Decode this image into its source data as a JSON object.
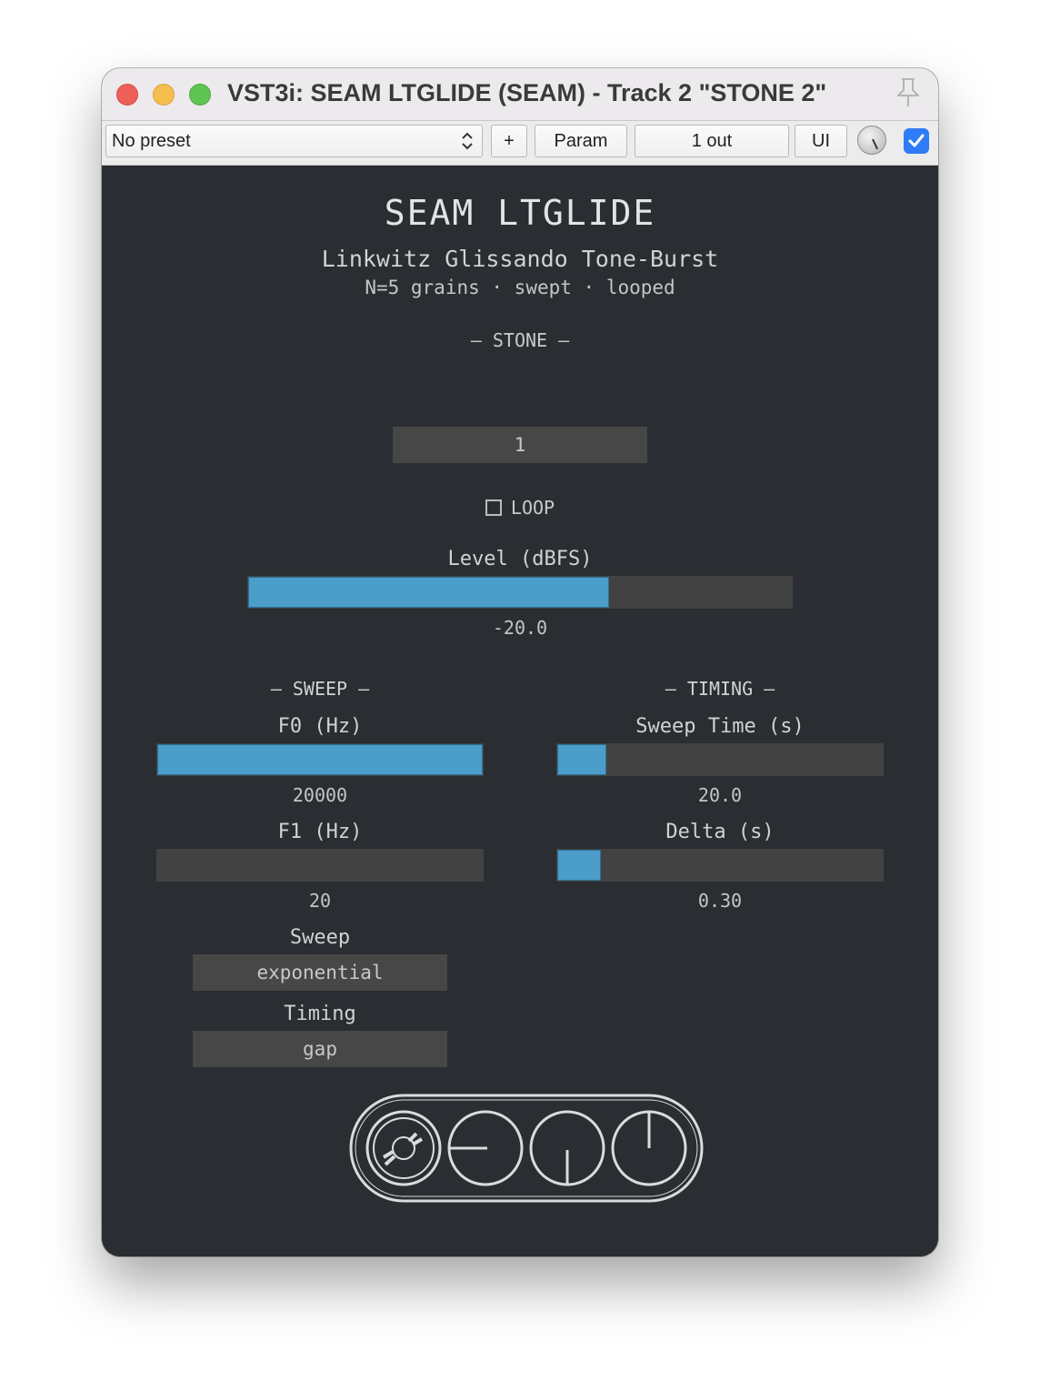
{
  "window": {
    "title": "VST3i: SEAM LTGLIDE (SEAM) - Track 2 \"STONE 2\""
  },
  "toolbar": {
    "preset": "No preset",
    "add_label": "+",
    "param_label": "Param",
    "out_label": "1 out",
    "ui_label": "UI",
    "enabled": true
  },
  "plugin": {
    "title": "SEAM LTGLIDE",
    "subtitle": "Linkwitz Glissando Tone-Burst",
    "info": "N=5 grains · swept · looped",
    "stone_header": "— STONE —",
    "stone_value": "1",
    "loop_label": "LOOP",
    "loop_checked": false,
    "level": {
      "label": "Level (dBFS)",
      "value": "-20.0",
      "fraction": 0.665
    },
    "sweep_header": "— SWEEP —",
    "timing_header": "— TIMING —",
    "f0": {
      "label": "F0 (Hz)",
      "value": "20000",
      "fraction": 1.0
    },
    "f1": {
      "label": "F1 (Hz)",
      "value": "20",
      "fraction": 0.0
    },
    "sweep_time": {
      "label": "Sweep Time (s)",
      "value": "20.0",
      "fraction": 0.155
    },
    "delta": {
      "label": "Delta (s)",
      "value": "0.30",
      "fraction": 0.14
    },
    "sweep_mode": {
      "label": "Sweep",
      "value": "exponential"
    },
    "timing_mode": {
      "label": "Timing",
      "value": "gap"
    }
  },
  "colors": {
    "panel_bg": "#2a2d31",
    "slider_fill": "#4a9ec9",
    "slider_track": "#424242"
  }
}
